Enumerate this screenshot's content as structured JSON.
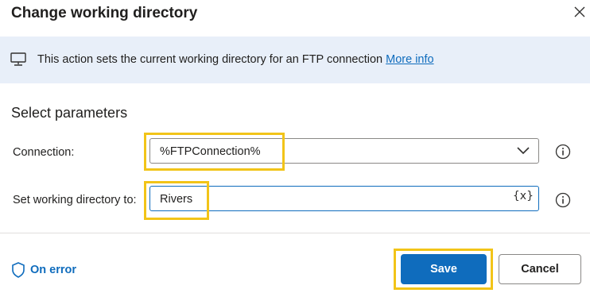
{
  "dialog": {
    "title": "Change working directory",
    "close_icon": "close-icon"
  },
  "info": {
    "icon": "monitor-icon",
    "text": "This action sets the current working directory for an FTP connection",
    "link": "More info"
  },
  "section_title": "Select parameters",
  "fields": {
    "connection": {
      "label": "Connection:",
      "value": "%FTPConnection%",
      "icon": "chevron-down-icon"
    },
    "working_directory": {
      "label": "Set working directory to:",
      "value": "Rivers",
      "var_button": "{x}"
    }
  },
  "footer": {
    "on_error": "On error",
    "save": "Save",
    "cancel": "Cancel"
  },
  "colors": {
    "accent": "#0f6cbd",
    "highlight": "#f2c418",
    "info_bar": "#e8eff9"
  }
}
